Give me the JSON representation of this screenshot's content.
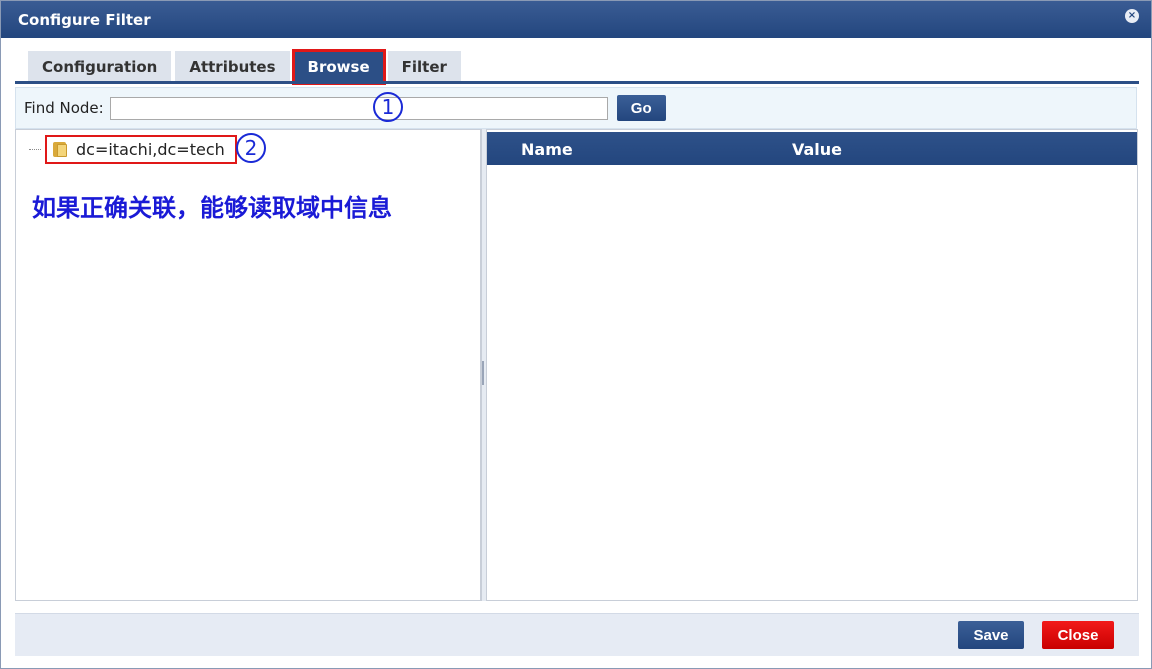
{
  "dialog": {
    "title": "Configure Filter",
    "close_icon": "×"
  },
  "tabs": [
    {
      "label": "Configuration",
      "active": false
    },
    {
      "label": "Attributes",
      "active": false
    },
    {
      "label": "Browse",
      "active": true
    },
    {
      "label": "Filter",
      "active": false
    }
  ],
  "find": {
    "label": "Find Node:",
    "value": "",
    "go_label": "Go"
  },
  "annotations": {
    "marker1": "1",
    "marker2": "2",
    "note": "如果正确关联，能够读取域中信息",
    "note_color": "#1a1ad6",
    "highlight_color": "#e01818"
  },
  "tree": {
    "nodes": [
      {
        "label": "dc=itachi,dc=tech",
        "icon": "folder-icon"
      }
    ]
  },
  "grid": {
    "columns": [
      "Name",
      "Value"
    ],
    "rows": []
  },
  "footer": {
    "save_label": "Save",
    "close_label": "Close"
  }
}
